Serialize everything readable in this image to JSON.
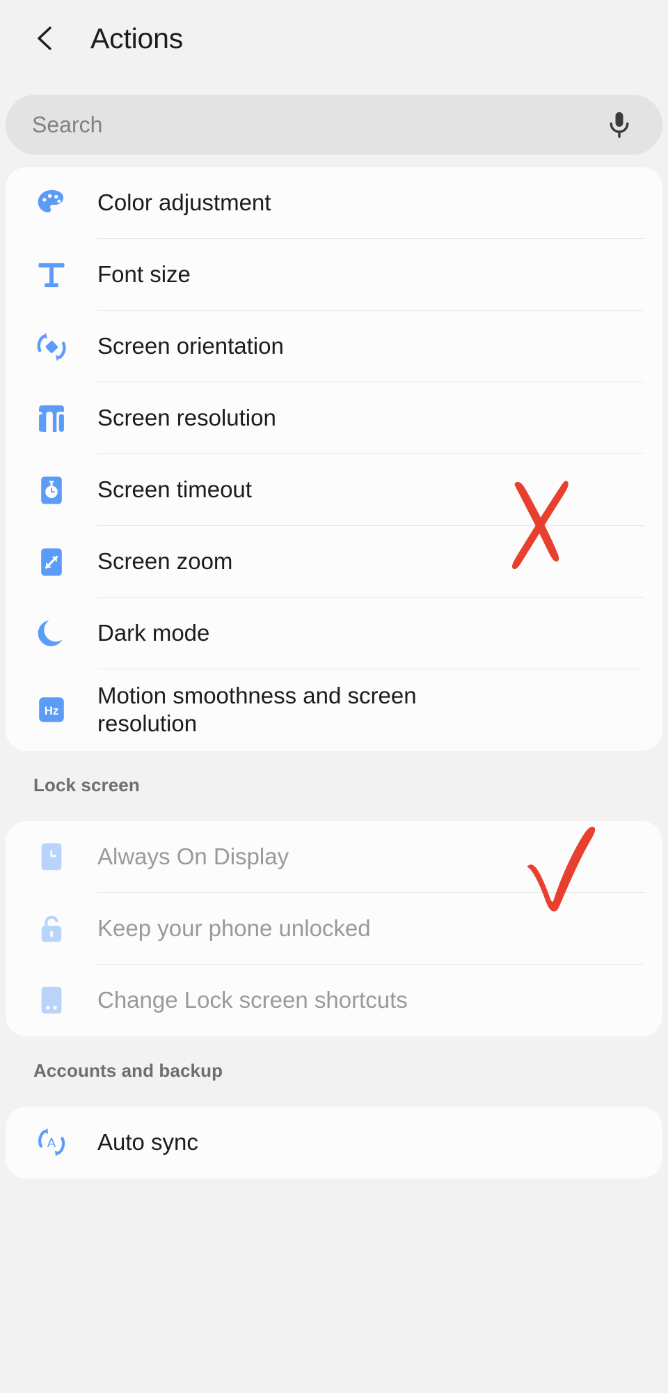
{
  "header": {
    "title": "Actions",
    "back_icon": "chevron-left-icon"
  },
  "search": {
    "placeholder": "Search",
    "value": "",
    "mic_icon": "microphone-icon"
  },
  "sections": [
    {
      "header": null,
      "items": [
        {
          "label": "Color adjustment",
          "icon": "palette-icon",
          "disabled": false
        },
        {
          "label": "Font size",
          "icon": "font-size-icon",
          "disabled": false
        },
        {
          "label": "Screen orientation",
          "icon": "screen-rotation-icon",
          "disabled": false
        },
        {
          "label": "Screen resolution",
          "icon": "screen-resolution-icon",
          "disabled": false
        },
        {
          "label": "Screen timeout",
          "icon": "screen-timeout-icon",
          "disabled": false
        },
        {
          "label": "Screen zoom",
          "icon": "screen-zoom-icon",
          "disabled": false
        },
        {
          "label": "Dark mode",
          "icon": "moon-icon",
          "disabled": false
        },
        {
          "label": "Motion smoothness and screen resolution",
          "icon": "hz-icon",
          "disabled": false
        }
      ]
    },
    {
      "header": "Lock screen",
      "items": [
        {
          "label": "Always On Display",
          "icon": "always-on-display-icon",
          "disabled": true
        },
        {
          "label": "Keep your phone unlocked",
          "icon": "unlock-icon",
          "disabled": true
        },
        {
          "label": "Change Lock screen shortcuts",
          "icon": "lock-shortcuts-icon",
          "disabled": true
        }
      ]
    },
    {
      "header": "Accounts and backup",
      "items": [
        {
          "label": "Auto sync",
          "icon": "auto-sync-icon",
          "disabled": false
        }
      ]
    }
  ],
  "annotations": [
    {
      "type": "cross-mark",
      "target": "Screen resolution",
      "color": "#e8402f"
    },
    {
      "type": "check-mark",
      "target": "Motion smoothness and screen resolution",
      "color": "#e8402f"
    }
  ],
  "colors": {
    "accent_blue": "#5a9cf8",
    "accent_blue_disabled": "#b9d4fb",
    "background": "#f2f2f2",
    "card": "#fcfcfc",
    "annotation_red": "#e8402f",
    "text_primary": "#1c1c1c",
    "text_secondary": "#6e6e6e",
    "text_disabled": "#9a9a9a"
  }
}
